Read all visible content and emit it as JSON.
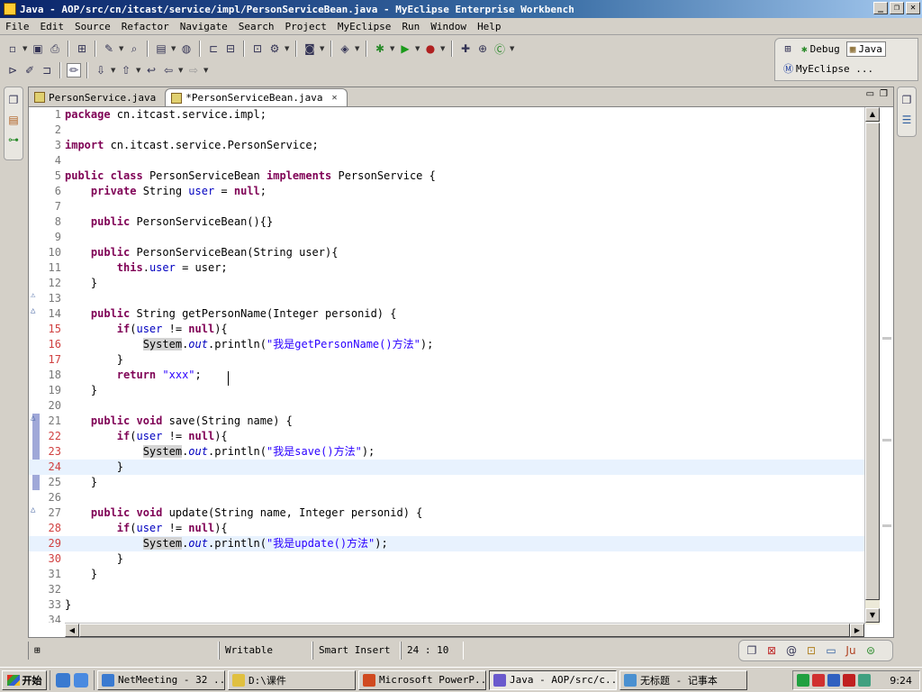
{
  "window": {
    "title": "Java - AOP/src/cn/itcast/service/impl/PersonServiceBean.java - MyEclipse Enterprise Workbench"
  },
  "menu": [
    "File",
    "Edit",
    "Source",
    "Refactor",
    "Navigate",
    "Search",
    "Project",
    "MyEclipse",
    "Run",
    "Window",
    "Help"
  ],
  "perspectives": {
    "debug": "Debug",
    "java": "Java",
    "myeclipse": "MyEclipse ..."
  },
  "editor": {
    "tabs": [
      {
        "label": "PersonService.java",
        "active": false
      },
      {
        "label": "*PersonServiceBean.java",
        "active": true
      }
    ],
    "line_numbers": [
      "1",
      "2",
      "3",
      "4",
      "5",
      "6",
      "7",
      "8",
      "9",
      "10",
      "11",
      "12",
      "13",
      "14",
      "15",
      "16",
      "17",
      "18",
      "19",
      "20",
      "21",
      "22",
      "23",
      "24",
      "25",
      "26",
      "27",
      "28",
      "29",
      "30",
      "31",
      "32",
      "33",
      "34"
    ],
    "lines": {
      "l1": [
        "package",
        " cn.itcast.service.impl;"
      ],
      "l3": [
        "import",
        " cn.itcast.service.PersonService;"
      ],
      "l5": [
        "public",
        " ",
        "class",
        " PersonServiceBean ",
        "implements",
        " PersonService {"
      ],
      "l6": [
        "    ",
        "private",
        " String ",
        "user",
        " = ",
        "null",
        ";"
      ],
      "l8": [
        "    ",
        "public",
        " PersonServiceBean(){}"
      ],
      "l10": [
        "    ",
        "public",
        " PersonServiceBean(String user){"
      ],
      "l11": [
        "        ",
        "this",
        ".",
        "user",
        " = user;"
      ],
      "l12": [
        "    }"
      ],
      "l14": [
        "    ",
        "public",
        " String getPersonName(Integer personid) {"
      ],
      "l15": [
        "        ",
        "if",
        "(",
        "user",
        " != ",
        "null",
        "){"
      ],
      "l16": [
        "            ",
        "System",
        ".",
        "out",
        ".println(",
        "\"我是getPersonName()方法\"",
        ");"
      ],
      "l17": [
        "        }"
      ],
      "l18": [
        "        ",
        "return",
        " ",
        "\"xxx\"",
        ";"
      ],
      "l19": [
        "    }"
      ],
      "l21": [
        "    ",
        "public",
        " ",
        "void",
        " save(String name) {"
      ],
      "l22": [
        "        ",
        "if",
        "(",
        "user",
        " != ",
        "null",
        "){"
      ],
      "l23": [
        "            ",
        "System",
        ".",
        "out",
        ".println(",
        "\"我是save()方法\"",
        ");"
      ],
      "l24": [
        "        }"
      ],
      "l25": [
        "    }"
      ],
      "l27": [
        "    ",
        "public",
        " ",
        "void",
        " update(String name, Integer personid) {"
      ],
      "l28": [
        "        ",
        "if",
        "(",
        "user",
        " != ",
        "null",
        "){"
      ],
      "l29": [
        "            ",
        "System",
        ".",
        "out",
        ".println(",
        "\"我是update()方法\"",
        ");"
      ],
      "l30": [
        "        }"
      ],
      "l31": [
        "    }"
      ],
      "l33": [
        "}"
      ]
    }
  },
  "status": {
    "mode": "Writable",
    "insert": "Smart Insert",
    "position": "24 : 10"
  },
  "taskbar": {
    "start": "开始",
    "buttons": [
      {
        "label": "NetMeeting - 32 ...",
        "color": "#3a7ad0"
      },
      {
        "label": "D:\\课件",
        "color": "#e0c040"
      },
      {
        "label": "Microsoft PowerP...",
        "color": "#d04a20"
      },
      {
        "label": "Java - AOP/src/c...",
        "color": "#6a5acd"
      },
      {
        "label": "无标题 - 记事本",
        "color": "#4a90d0"
      }
    ],
    "clock": "9:24"
  }
}
